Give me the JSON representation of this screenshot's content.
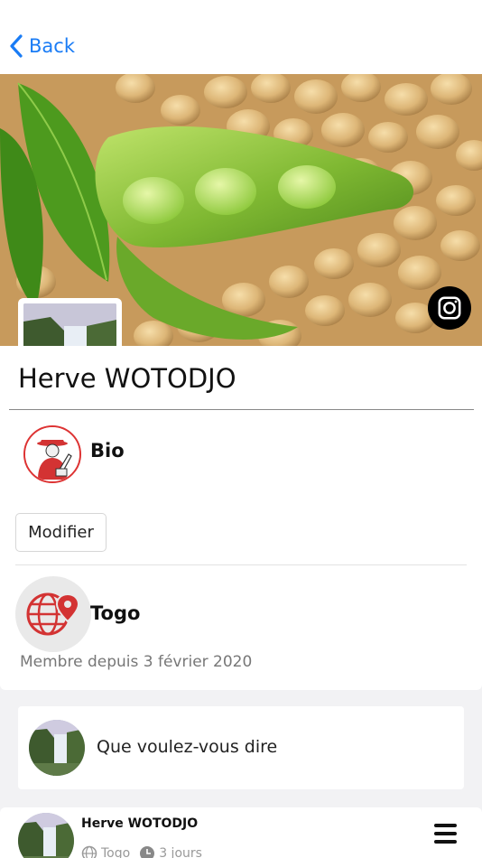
{
  "nav": {
    "back_label": "Back"
  },
  "profile": {
    "name": "Herve WOTODJO",
    "bio_label": "Bio",
    "edit_button": "Modifier",
    "country": "Togo",
    "member_since": "Membre depuis 3 février 2020"
  },
  "composer": {
    "prompt": "Que voulez-vous dire"
  },
  "feed": {
    "author": "Herve WOTODJO",
    "location": "Togo",
    "time": "3 jours"
  },
  "colors": {
    "accent": "#1a7cf5",
    "bio_red": "#d33333",
    "background": "#f2f2f4"
  },
  "icons": [
    "chevron-left-icon",
    "camera-icon",
    "writer-icon",
    "globe-pin-icon",
    "hamburger-menu-icon",
    "globe-small-icon",
    "clock-icon"
  ]
}
